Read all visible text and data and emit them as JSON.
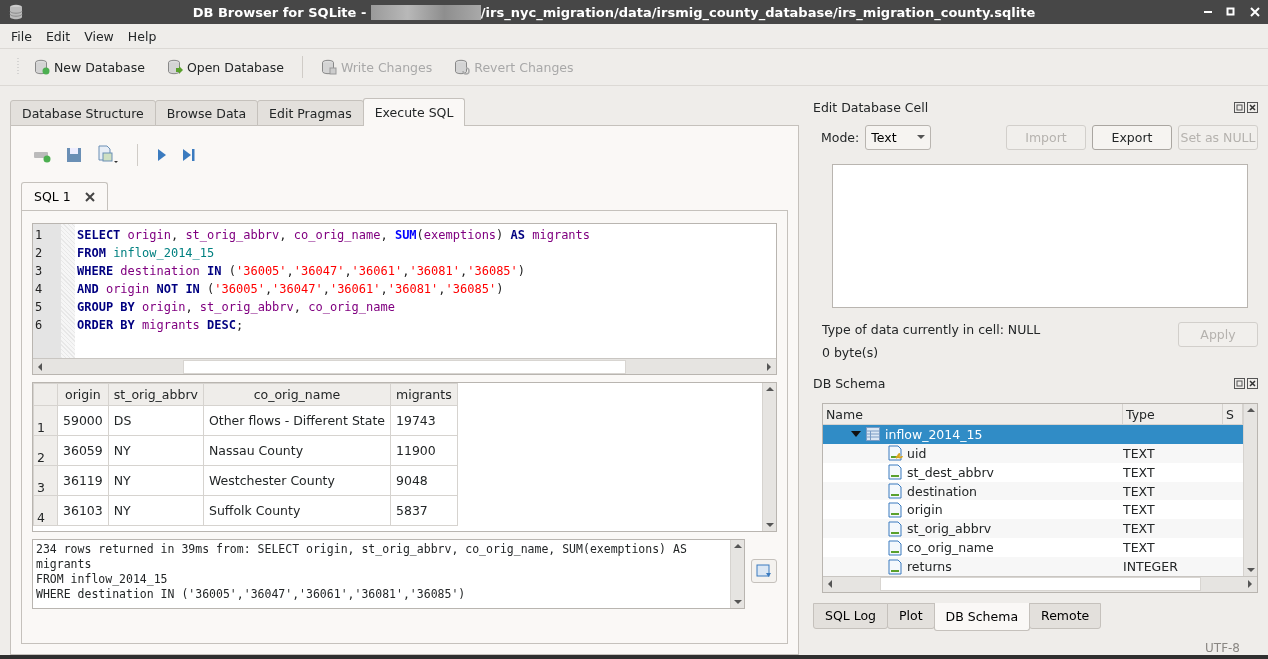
{
  "window": {
    "title": "DB Browser for SQLite - ",
    "path": "/irs_nyc_migration/data/irsmig_county_database/irs_migration_county.sqlite"
  },
  "menu": [
    "File",
    "Edit",
    "View",
    "Help"
  ],
  "toolbar": [
    {
      "label": "New Database",
      "kind": "new",
      "disabled": false
    },
    {
      "label": "Open Database",
      "kind": "open",
      "disabled": false
    },
    {
      "label": "Write Changes",
      "kind": "write",
      "disabled": true
    },
    {
      "label": "Revert Changes",
      "kind": "revert",
      "disabled": true
    }
  ],
  "main_tabs": [
    {
      "label": "Database Structure",
      "selected": false
    },
    {
      "label": "Browse Data",
      "selected": false
    },
    {
      "label": "Edit Pragmas",
      "selected": false
    },
    {
      "label": "Execute SQL",
      "selected": true
    }
  ],
  "editor_tabs": [
    {
      "label": "SQL 1",
      "selected": true
    }
  ],
  "editor": {
    "lines": [
      {
        "number": "1",
        "tokens": [
          {
            "kind": "keyword",
            "text": "SELECT "
          },
          {
            "kind": "identifier",
            "text": "origin"
          },
          {
            "kind": "plain",
            "text": ", "
          },
          {
            "kind": "identifier",
            "text": "st_orig_abbrv"
          },
          {
            "kind": "plain",
            "text": ", "
          },
          {
            "kind": "identifier",
            "text": "co_orig_name"
          },
          {
            "kind": "plain",
            "text": ", "
          },
          {
            "kind": "function",
            "text": "SUM"
          },
          {
            "kind": "plain",
            "text": "("
          },
          {
            "kind": "identifier",
            "text": "exemptions"
          },
          {
            "kind": "plain",
            "text": ") "
          },
          {
            "kind": "keyword",
            "text": "AS "
          },
          {
            "kind": "identifier",
            "text": "migrants"
          }
        ]
      },
      {
        "number": "2",
        "tokens": [
          {
            "kind": "keyword",
            "text": "FROM "
          },
          {
            "kind": "table",
            "text": "inflow_2014_15"
          }
        ]
      },
      {
        "number": "3",
        "tokens": [
          {
            "kind": "keyword",
            "text": "WHERE "
          },
          {
            "kind": "identifier",
            "text": "destination "
          },
          {
            "kind": "keyword",
            "text": "IN "
          },
          {
            "kind": "plain",
            "text": "("
          },
          {
            "kind": "string",
            "text": "'36005'"
          },
          {
            "kind": "plain",
            "text": ","
          },
          {
            "kind": "string",
            "text": "'36047'"
          },
          {
            "kind": "plain",
            "text": ","
          },
          {
            "kind": "string",
            "text": "'36061'"
          },
          {
            "kind": "plain",
            "text": ","
          },
          {
            "kind": "string",
            "text": "'36081'"
          },
          {
            "kind": "plain",
            "text": ","
          },
          {
            "kind": "string",
            "text": "'36085'"
          },
          {
            "kind": "plain",
            "text": ")"
          }
        ]
      },
      {
        "number": "4",
        "tokens": [
          {
            "kind": "keyword",
            "text": "AND "
          },
          {
            "kind": "identifier",
            "text": "origin "
          },
          {
            "kind": "keyword",
            "text": "NOT IN "
          },
          {
            "kind": "plain",
            "text": "("
          },
          {
            "kind": "string",
            "text": "'36005'"
          },
          {
            "kind": "plain",
            "text": ","
          },
          {
            "kind": "string",
            "text": "'36047'"
          },
          {
            "kind": "plain",
            "text": ","
          },
          {
            "kind": "string",
            "text": "'36061'"
          },
          {
            "kind": "plain",
            "text": ","
          },
          {
            "kind": "string",
            "text": "'36081'"
          },
          {
            "kind": "plain",
            "text": ","
          },
          {
            "kind": "string",
            "text": "'36085'"
          },
          {
            "kind": "plain",
            "text": ")"
          }
        ]
      },
      {
        "number": "5",
        "tokens": [
          {
            "kind": "keyword",
            "text": "GROUP BY "
          },
          {
            "kind": "identifier",
            "text": "origin"
          },
          {
            "kind": "plain",
            "text": ", "
          },
          {
            "kind": "identifier",
            "text": "st_orig_abbrv"
          },
          {
            "kind": "plain",
            "text": ", "
          },
          {
            "kind": "identifier",
            "text": "co_orig_name"
          }
        ]
      },
      {
        "number": "6",
        "tokens": [
          {
            "kind": "keyword",
            "text": "ORDER BY "
          },
          {
            "kind": "identifier",
            "text": "migrants "
          },
          {
            "kind": "keyword",
            "text": "DESC"
          },
          {
            "kind": "plain",
            "text": ";"
          }
        ]
      }
    ]
  },
  "results": {
    "columns": [
      "origin",
      "st_orig_abbrv",
      "co_orig_name",
      "migrants"
    ],
    "rows": [
      {
        "number": "1",
        "cells": [
          "59000",
          "DS",
          "Other flows - Different State",
          "19743"
        ]
      },
      {
        "number": "2",
        "cells": [
          "36059",
          "NY",
          "Nassau County",
          "11900"
        ]
      },
      {
        "number": "3",
        "cells": [
          "36119",
          "NY",
          "Westchester County",
          "9048"
        ]
      },
      {
        "number": "4",
        "cells": [
          "36103",
          "NY",
          "Suffolk County",
          "5837"
        ]
      }
    ]
  },
  "message": {
    "lines": [
      "234 rows returned in 39ms from: SELECT origin, st_orig_abbrv, co_orig_name, SUM(exemptions) AS",
      "migrants",
      "FROM inflow_2014_15",
      "WHERE destination IN ('36005','36047','36061','36081','36085')"
    ]
  },
  "edit_cell": {
    "title": "Edit Database Cell",
    "mode_label": "Mode:",
    "mode_value": "Text",
    "buttons": [
      {
        "label": "Import",
        "disabled": true
      },
      {
        "label": "Export",
        "disabled": false
      },
      {
        "label": "Set as NULL",
        "disabled": true
      }
    ],
    "type_info": "Type of data currently in cell: NULL",
    "size_info": "0 byte(s)",
    "apply": {
      "label": "Apply",
      "disabled": true
    }
  },
  "schema": {
    "title": "DB Schema",
    "columns": [
      "Name",
      "Type",
      "S"
    ],
    "tree": [
      {
        "name": "inflow_2014_15",
        "kind": "table",
        "expanded": true,
        "selected": true,
        "children": [
          {
            "name": "uid",
            "type": "TEXT",
            "kind": "key",
            "selected": false
          },
          {
            "name": "st_dest_abbrv",
            "type": "TEXT",
            "kind": "field",
            "selected": false
          },
          {
            "name": "destination",
            "type": "TEXT",
            "kind": "field",
            "selected": false
          },
          {
            "name": "origin",
            "type": "TEXT",
            "kind": "field",
            "selected": false
          },
          {
            "name": "st_orig_abbrv",
            "type": "TEXT",
            "kind": "field",
            "selected": false
          },
          {
            "name": "co_orig_name",
            "type": "TEXT",
            "kind": "field",
            "selected": false
          },
          {
            "name": "returns",
            "type": "INTEGER",
            "kind": "field",
            "selected": false
          }
        ]
      }
    ]
  },
  "dock_tabs": [
    {
      "label": "SQL Log",
      "selected": false
    },
    {
      "label": "Plot",
      "selected": false
    },
    {
      "label": "DB Schema",
      "selected": true
    },
    {
      "label": "Remote",
      "selected": false
    }
  ],
  "status_bar": {
    "encoding": "UTF-8"
  }
}
